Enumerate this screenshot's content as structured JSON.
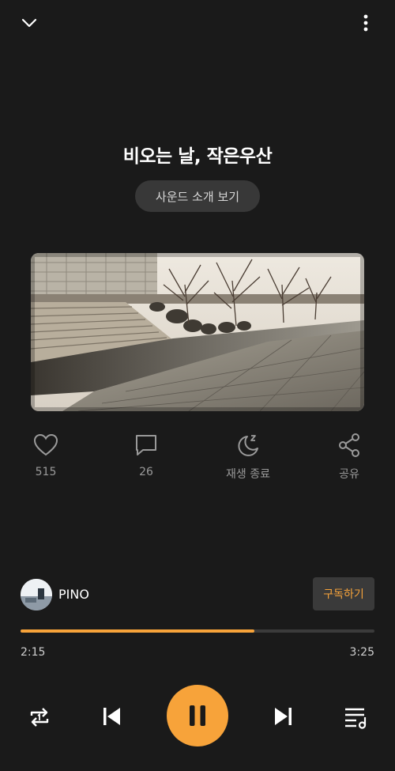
{
  "track": {
    "title": "비오는 날, 작은우산",
    "intro_label": "사운드 소개 보기"
  },
  "actions": {
    "like_count": "515",
    "comment_count": "26",
    "sleep_timer_label": "재생 종료",
    "share_label": "공유"
  },
  "channel": {
    "name": "PINO",
    "subscribe_label": "구독하기"
  },
  "playback": {
    "current_time": "2:15",
    "total_time": "3:25",
    "progress": 0.66,
    "state": "playing"
  },
  "colors": {
    "accent": "#f7a33a",
    "background": "#1a1a1a",
    "secondary_text": "#9a9a9a"
  },
  "icons": {
    "collapse": "chevron-down-icon",
    "more": "more-vertical-icon",
    "like": "heart-icon",
    "comment": "comment-icon",
    "sleep": "moon-zz-icon",
    "share": "share-icon",
    "repeat": "repeat-one-icon",
    "previous": "skip-previous-icon",
    "pause": "pause-icon",
    "next": "skip-next-icon",
    "playlist": "playlist-icon"
  }
}
